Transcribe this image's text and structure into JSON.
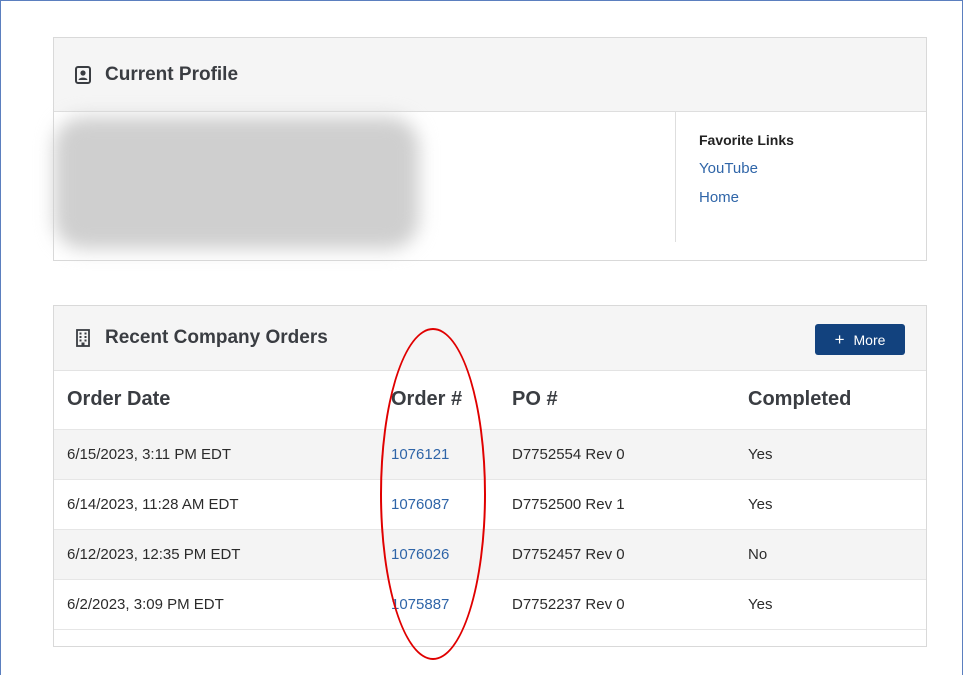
{
  "profile": {
    "title": "Current Profile",
    "icon": "contact-card-icon",
    "favorite_links": {
      "title": "Favorite Links",
      "links": [
        "YouTube",
        "Home"
      ]
    }
  },
  "orders": {
    "title": "Recent Company Orders",
    "icon": "building-icon",
    "more_button": {
      "plus": "+",
      "label": "More"
    },
    "columns": [
      "Order Date",
      "Order #",
      "PO #",
      "Completed"
    ],
    "rows": [
      {
        "date": "6/15/2023, 3:11 PM EDT",
        "order": "1076121",
        "po": "D7752554 Rev 0",
        "completed": "Yes"
      },
      {
        "date": "6/14/2023, 11:28 AM EDT",
        "order": "1076087",
        "po": "D7752500 Rev 1",
        "completed": "Yes"
      },
      {
        "date": "6/12/2023, 12:35 PM EDT",
        "order": "1076026",
        "po": "D7752457 Rev 0",
        "completed": "No"
      },
      {
        "date": "6/2/2023, 3:09 PM EDT",
        "order": "1075887",
        "po": "D7752237 Rev 0",
        "completed": "Yes"
      }
    ]
  },
  "colors": {
    "accent": "#12427e",
    "link": "#2f65a8",
    "annotation": "#e00000"
  }
}
